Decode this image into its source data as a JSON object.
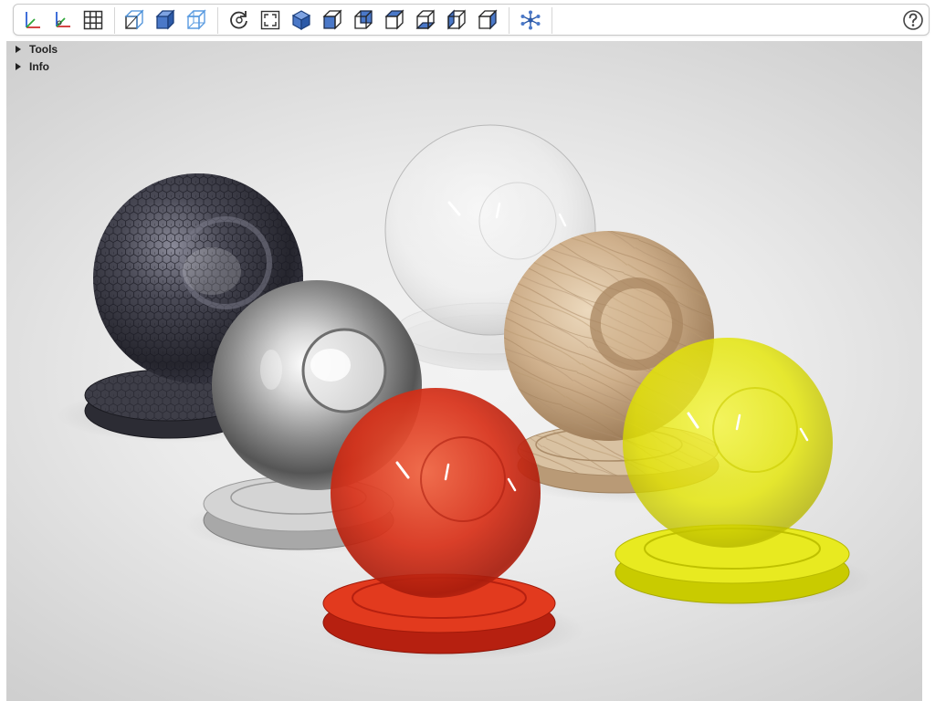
{
  "toolbar": {
    "buttons": [
      {
        "name": "axes-icon"
      },
      {
        "name": "axes-origin-icon"
      },
      {
        "name": "grid-icon"
      },
      {
        "name": "bounding-box-icon"
      },
      {
        "name": "solid-cube-icon"
      },
      {
        "name": "wireframe-cube-icon"
      },
      {
        "name": "reset-view-icon"
      },
      {
        "name": "fit-view-icon"
      },
      {
        "name": "iso-view-icon"
      },
      {
        "name": "front-view-icon"
      },
      {
        "name": "back-view-icon"
      },
      {
        "name": "top-view-icon"
      },
      {
        "name": "bottom-view-icon"
      },
      {
        "name": "left-view-icon"
      },
      {
        "name": "right-view-icon"
      },
      {
        "name": "explode-icon"
      },
      {
        "name": "help-icon"
      }
    ]
  },
  "panels": {
    "tools": {
      "label": "Tools"
    },
    "info": {
      "label": "Info"
    }
  },
  "scene": {
    "materials": [
      {
        "name": "hex-metal",
        "color": "#3a3a44"
      },
      {
        "name": "clear-glass",
        "color": "#e6e6e6"
      },
      {
        "name": "chrome",
        "color": "#b8b8b8"
      },
      {
        "name": "wood",
        "color": "#c9ab88"
      },
      {
        "name": "red-plastic",
        "color": "#d8321c"
      },
      {
        "name": "yellow-glass",
        "color": "#e6e800"
      }
    ]
  }
}
